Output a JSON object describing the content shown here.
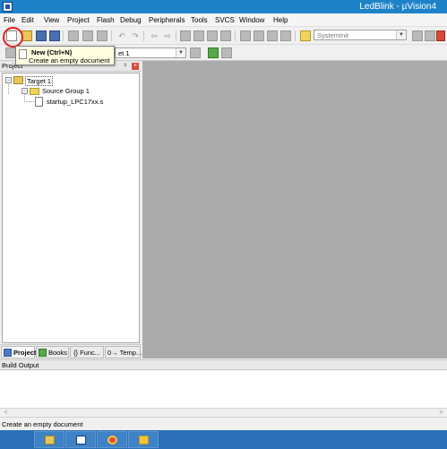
{
  "window": {
    "title": "LedBlink  - µVision4"
  },
  "menu": [
    "File",
    "Edit",
    "View",
    "Project",
    "Flash",
    "Debug",
    "Peripherals",
    "Tools",
    "SVCS",
    "Window",
    "Help"
  ],
  "toolbar": {
    "function_combo": "SystemInit",
    "target_combo": "et 1"
  },
  "tooltip": {
    "title": "New (Ctrl+N)",
    "description": "Create an empty document"
  },
  "project_panel": {
    "title": "Project",
    "tree": {
      "target": "Target 1",
      "group": "Source Group 1",
      "file": "startup_LPC17xx.s"
    },
    "tabs": [
      "Project",
      "Books",
      "{} Func...",
      "0→ Temp..."
    ]
  },
  "build_output": {
    "title": "Build Output"
  },
  "status": {
    "text": "Create an empty document"
  },
  "taskbar": [
    "file-explorer-icon",
    "uvision-icon",
    "chrome-icon",
    "paint-icon"
  ],
  "colors": {
    "title_bar": "#1e82c9",
    "editor_bg": "#ababab",
    "taskbar": "#2b6fb6",
    "highlight": "#e02020"
  }
}
